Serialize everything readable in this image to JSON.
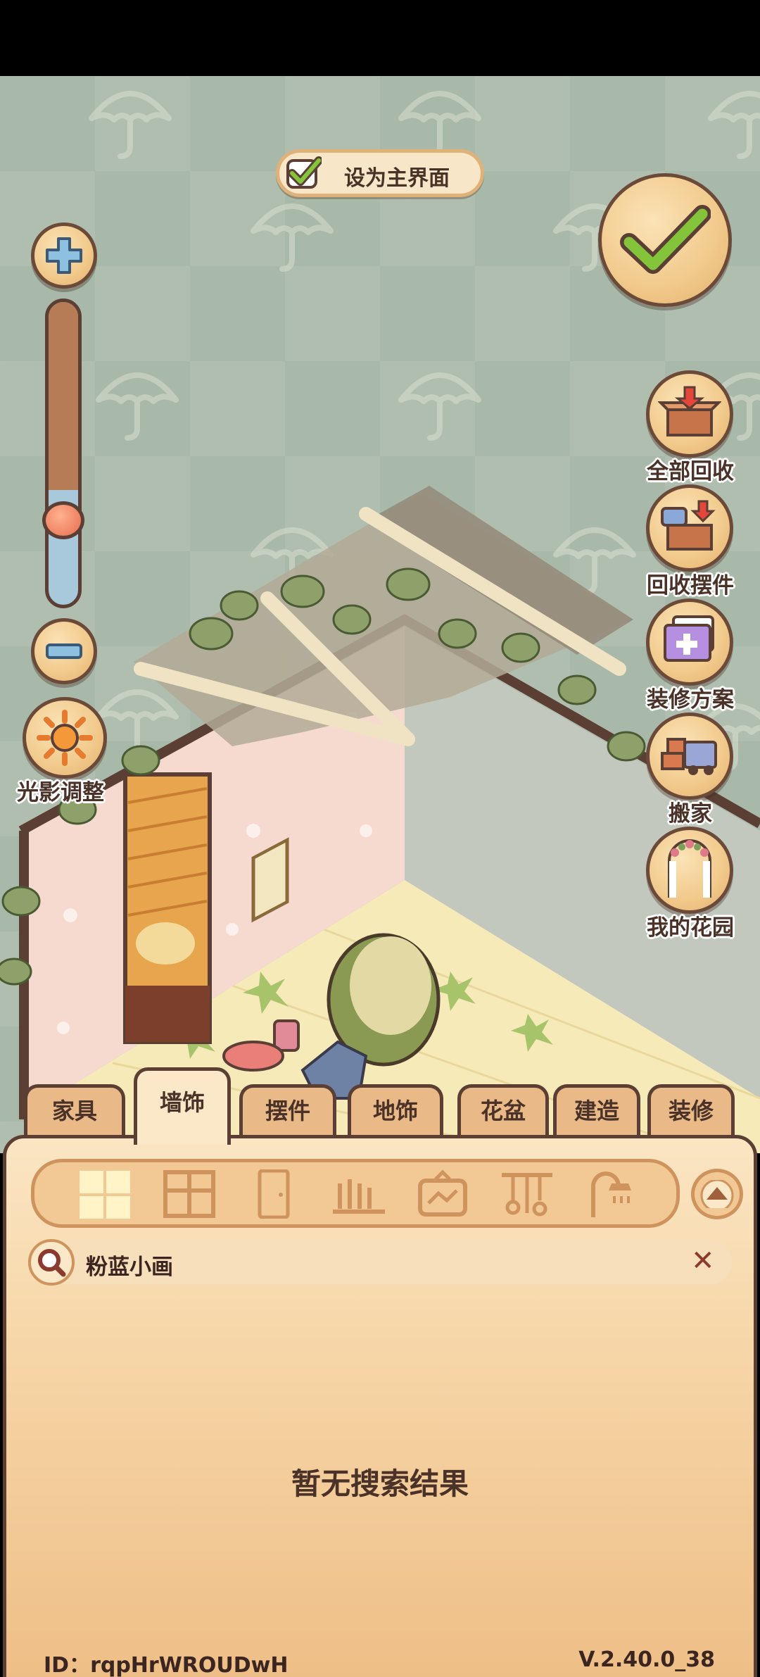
{
  "top": {
    "set_main_label": "设为主界面"
  },
  "light_label": "光影调整",
  "zoom": {
    "level": 0.38
  },
  "side_buttons": [
    {
      "label": "全部回收",
      "icon": "box-recycle-icon"
    },
    {
      "label": "回收摆件",
      "icon": "item-recycle-icon"
    },
    {
      "label": "装修方案",
      "icon": "plan-icon"
    },
    {
      "label": "搬家",
      "icon": "moving-truck-icon"
    },
    {
      "label": "我的花园",
      "icon": "garden-arch-icon"
    }
  ],
  "tabs": [
    "家具",
    "墙饰",
    "摆件",
    "地饰",
    "花盆",
    "建造",
    "装修"
  ],
  "active_tab": "墙饰",
  "categories": [
    "window-grid-icon",
    "window-icon",
    "door-icon",
    "fence-icon",
    "frame-icon",
    "rack-icon",
    "shower-icon"
  ],
  "search": {
    "value": "粉蓝小画"
  },
  "empty_message": "暂无搜索结果",
  "footer": {
    "id": "ID：rqpHrWROUDwH",
    "version": "V.2.40.0_38"
  },
  "colors": {
    "panel": "#f6d5a6",
    "outline": "#5b3f34",
    "accent_green": "#7cbf3a",
    "background": "#a9b9a9"
  }
}
